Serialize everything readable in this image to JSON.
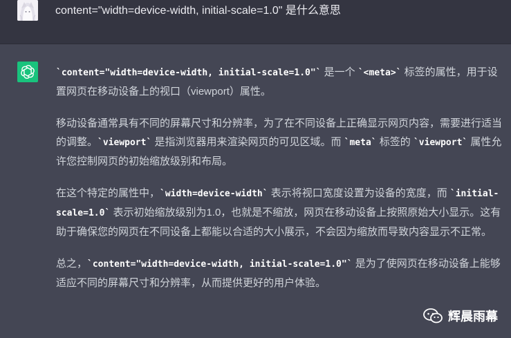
{
  "user_message": {
    "text": "content=\"width=device-width, initial-scale=1.0\" 是什么意思"
  },
  "assistant_message": {
    "paragraphs": [
      [
        {
          "type": "code",
          "text": "`content=\"width=device-width, initial-scale=1.0\"`"
        },
        {
          "type": "text",
          "text": " 是一个 "
        },
        {
          "type": "code",
          "text": "`<meta>`"
        },
        {
          "type": "text",
          "text": " 标签的属性，用于设置网页在移动设备上的视口（viewport）属性。"
        }
      ],
      [
        {
          "type": "text",
          "text": "移动设备通常具有不同的屏幕尺寸和分辨率，为了在不同设备上正确显示网页内容，需要进行适当的调整。"
        },
        {
          "type": "code",
          "text": "`viewport`"
        },
        {
          "type": "text",
          "text": " 是指浏览器用来渲染网页的可见区域。而 "
        },
        {
          "type": "code",
          "text": "`meta`"
        },
        {
          "type": "text",
          "text": " 标签的 "
        },
        {
          "type": "code",
          "text": "`viewport`"
        },
        {
          "type": "text",
          "text": " 属性允许您控制网页的初始缩放级别和布局。"
        }
      ],
      [
        {
          "type": "text",
          "text": "在这个特定的属性中，"
        },
        {
          "type": "code",
          "text": "`width=device-width`"
        },
        {
          "type": "text",
          "text": " 表示将视口宽度设置为设备的宽度，而 "
        },
        {
          "type": "code",
          "text": "`initial-scale=1.0`"
        },
        {
          "type": "text",
          "text": " 表示初始缩放级别为1.0，也就是不缩放，网页在移动设备上按照原始大小显示。这有助于确保您的网页在不同设备上都能以合适的大小展示，不会因为缩放而导致内容显示不正常。"
        }
      ],
      [
        {
          "type": "text",
          "text": "总之，"
        },
        {
          "type": "code",
          "text": "`content=\"width=device-width, initial-scale=1.0\"`"
        },
        {
          "type": "text",
          "text": " 是为了使网页在移动设备上能够适应不同的屏幕尺寸和分辨率，从而提供更好的用户体验。"
        }
      ]
    ]
  },
  "watermark": {
    "icon": "wechat-icon",
    "text": "辉晨雨幕"
  },
  "colors": {
    "user_bg": "#343541",
    "assistant_bg": "#444654",
    "gpt_avatar": "#19c37d"
  }
}
